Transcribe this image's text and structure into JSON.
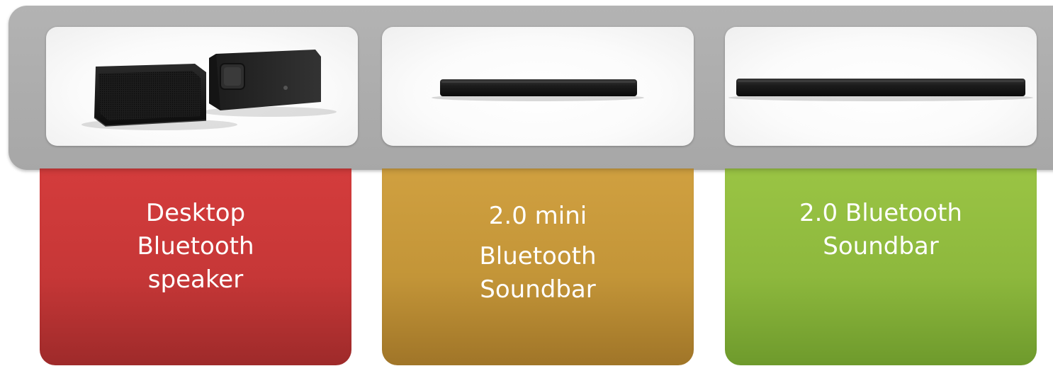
{
  "cards": [
    {
      "lines": [
        "Desktop",
        "Bluetooth",
        "speaker"
      ],
      "color": "#c63737",
      "image": "desktop-speaker-photo"
    },
    {
      "lines": [
        "2.0 mini",
        "Bluetooth",
        "Soundbar"
      ],
      "color": "#c39538",
      "image": "mini-soundbar-photo"
    },
    {
      "lines": [
        "2.0 Bluetooth",
        "Soundbar"
      ],
      "color": "#8db83d",
      "image": "soundbar-photo"
    }
  ],
  "colors": {
    "banner": "#a9a9a9",
    "text": "#ffffff"
  }
}
